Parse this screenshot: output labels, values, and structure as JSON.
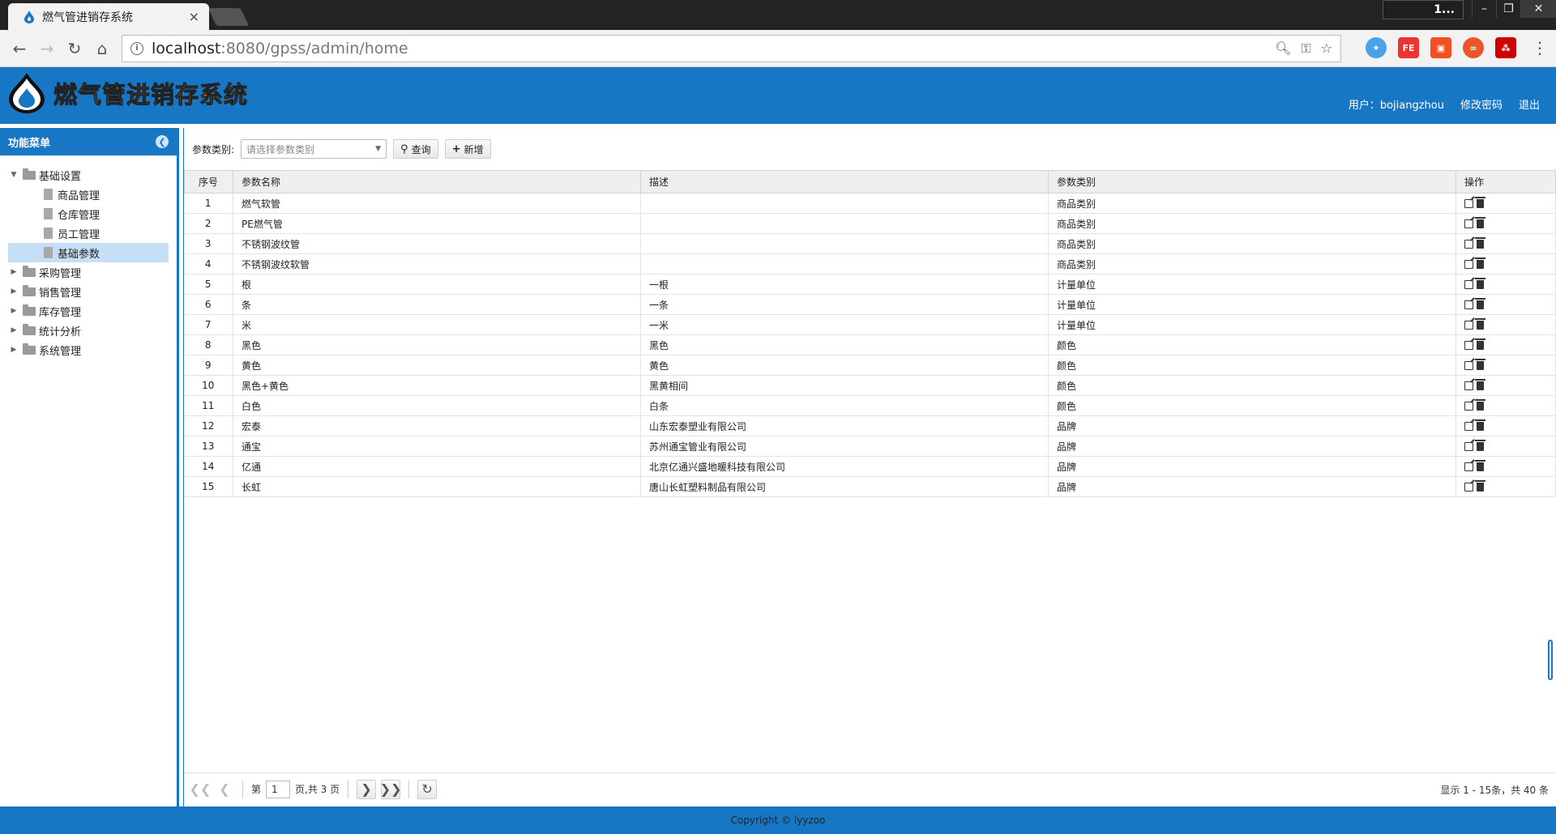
{
  "browser": {
    "tab_title": "燃气管进销存系统",
    "tab_close": "×",
    "user_chip": "1...",
    "url_host": "localhost",
    "url_rest": ":8080/gpss/admin/home",
    "ext_fe": "FE"
  },
  "header": {
    "logo_a": "燃气管",
    "logo_b": "进销存系统",
    "user_label": "用户：bojiangzhou",
    "change_pwd": "修改密码",
    "logout": "退出"
  },
  "sidebar": {
    "title": "功能菜单",
    "groups": [
      {
        "label": "基础设置",
        "expanded": true,
        "children": [
          "商品管理",
          "仓库管理",
          "员工管理",
          "基础参数"
        ],
        "selected": "基础参数"
      },
      {
        "label": "采购管理"
      },
      {
        "label": "销售管理"
      },
      {
        "label": "库存管理"
      },
      {
        "label": "统计分析"
      },
      {
        "label": "系统管理"
      }
    ]
  },
  "filter": {
    "label": "参数类别:",
    "placeholder": "请选择参数类别",
    "query_btn": "查询",
    "add_btn": "新增"
  },
  "table": {
    "headers": [
      "序号",
      "参数名称",
      "描述",
      "参数类别",
      "操作"
    ],
    "rows": [
      [
        "1",
        "燃气软管",
        "",
        "商品类别"
      ],
      [
        "2",
        "PE燃气管",
        "",
        "商品类别"
      ],
      [
        "3",
        "不锈钢波纹管",
        "",
        "商品类别"
      ],
      [
        "4",
        "不锈钢波纹软管",
        "",
        "商品类别"
      ],
      [
        "5",
        "根",
        "一根",
        "计量单位"
      ],
      [
        "6",
        "条",
        "一条",
        "计量单位"
      ],
      [
        "7",
        "米",
        "一米",
        "计量单位"
      ],
      [
        "8",
        "黑色",
        "黑色",
        "颜色"
      ],
      [
        "9",
        "黄色",
        "黄色",
        "颜色"
      ],
      [
        "10",
        "黑色+黄色",
        "黑黄相间",
        "颜色"
      ],
      [
        "11",
        "白色",
        "白条",
        "颜色"
      ],
      [
        "12",
        "宏泰",
        "山东宏泰塑业有限公司",
        "品牌"
      ],
      [
        "13",
        "通宝",
        "苏州通宝管业有限公司",
        "品牌"
      ],
      [
        "14",
        "亿通",
        "北京亿通兴盛地暖科技有限公司",
        "品牌"
      ],
      [
        "15",
        "长虹",
        "唐山长虹塑料制品有限公司",
        "品牌"
      ]
    ]
  },
  "pager": {
    "page_prefix": "第",
    "page_value": "1",
    "page_suffix": "页,共 3 页",
    "info": "显示 1 - 15条，共 40 条"
  },
  "footer": {
    "copyright": "Copyright © lyyzoo"
  },
  "colors": {
    "brand": "#1777c5",
    "selected_row": "#c4dff6"
  }
}
